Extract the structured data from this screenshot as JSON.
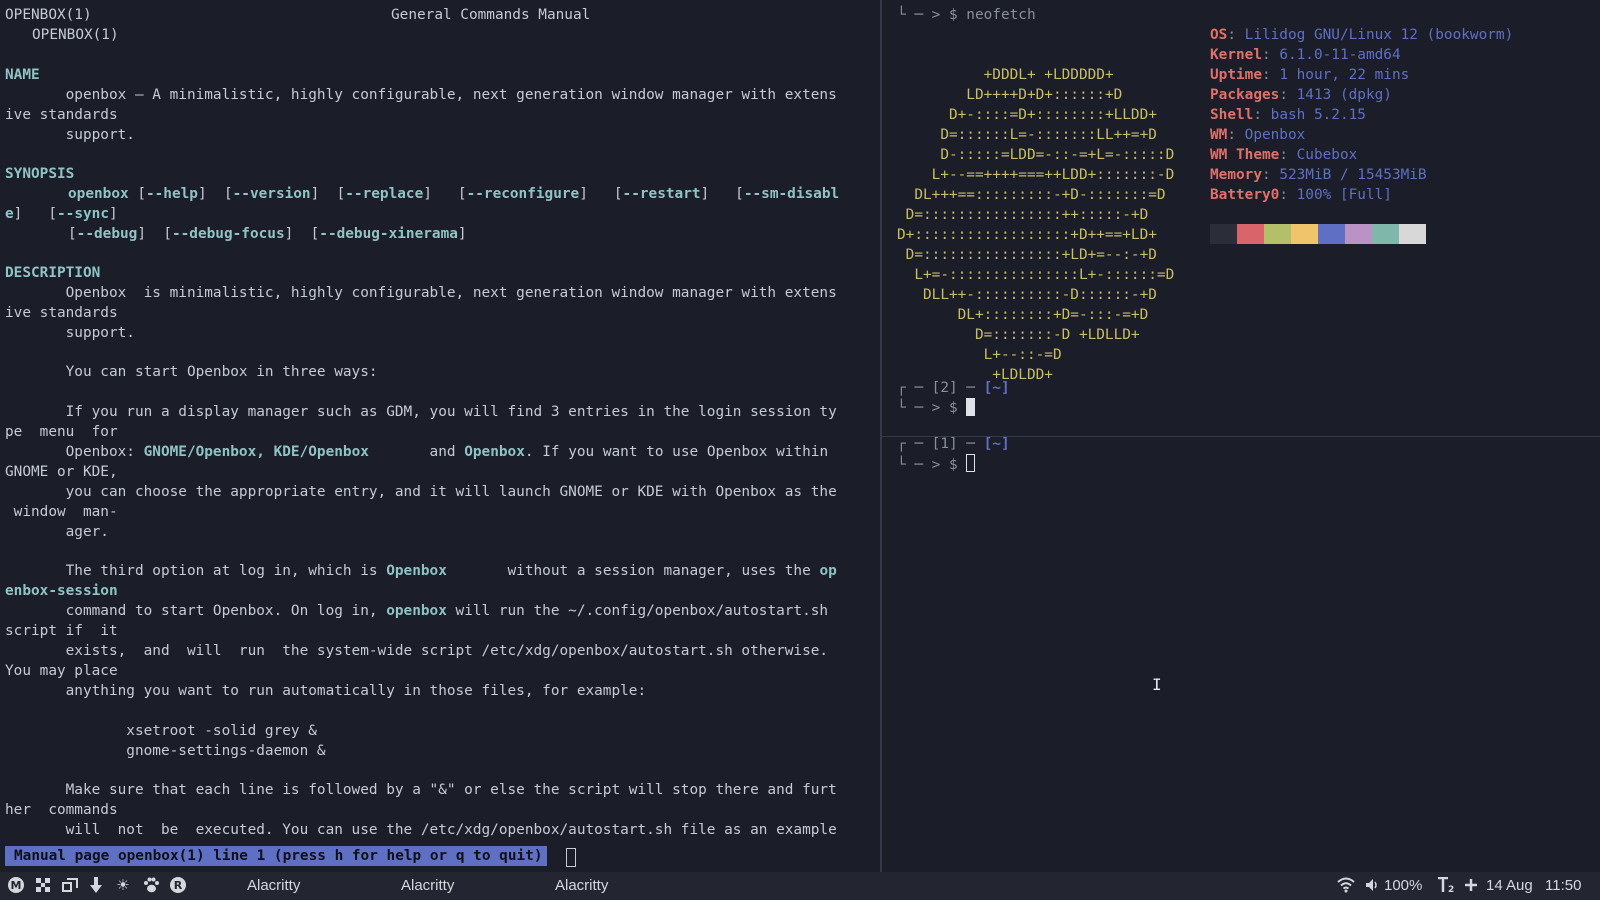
{
  "colors": {
    "background": "#1b1e28",
    "foreground": "#c6cad6",
    "bold": "#8fc3c6",
    "status_bg": "#5f6fc4",
    "logo": "#c8bd68",
    "label": "#e0706a",
    "value": "#5f6fc4"
  },
  "man": {
    "header_left": "OPENBOX(1)",
    "header_center": "General Commands Manual",
    "header_right": "OPENBOX(1)",
    "name_heading": "NAME",
    "name_line1": "       openbox — A minimalistic, highly configurable, next generation window manager with extens",
    "name_line2": "ive standards",
    "name_line3": "       support.",
    "synopsis_heading": "SYNOPSIS",
    "syn_cmd": "openbox",
    "syn_help": "--help",
    "syn_version": "--version",
    "syn_replace": "--replace",
    "syn_reconfigure": "--reconfigure",
    "syn_restart": "--restart",
    "syn_smdisable_a": "--sm-disabl",
    "syn_smdisable_b": "e",
    "syn_sync": "--sync",
    "syn_debug": "--debug",
    "syn_debug_focus": "--debug-focus",
    "syn_debug_xinerama": "--debug-xinerama",
    "description_heading": "DESCRIPTION",
    "d1": "       Openbox  is minimalistic, highly configurable, next generation window manager with extens",
    "d2": "ive standards",
    "d3": "       support.",
    "d4": "       You can start Openbox in three ways:",
    "d5": "       If you run a display manager such as GDM, you will find 3 entries in the login session ty",
    "d6": "pe  menu  for",
    "d7_a": "       Openbox: ",
    "d7_b": "GNOME/Openbox",
    "d7_c": ", ",
    "d7_d": "KDE/Openbox",
    "d7_e": "       and ",
    "d7_f": "Openbox",
    "d7_g": ". If you want to use Openbox within",
    "d8": "GNOME or KDE,",
    "d9": "       you can choose the appropriate entry, and it will launch GNOME or KDE with Openbox as the",
    "d10": " window  man-",
    "d11": "       ager.",
    "d12_a": "       The third option at log in, which is ",
    "d12_b": "Openbox",
    "d12_c": "       without a session manager, uses the ",
    "d12_d": "op",
    "d13": "enbox-session",
    "d14_a": "       command to start Openbox. On log in, ",
    "d14_b": "openbox",
    "d14_c": " will run the ~/.config/openbox/autostart.sh",
    "d15": "script if  it",
    "d16": "       exists,  and  will  run  the system-wide script /etc/xdg/openbox/autostart.sh otherwise.",
    "d17": "You may place",
    "d18": "       anything you want to run automatically in those files, for example:",
    "d19": "              xsetroot -solid grey &",
    "d20": "              gnome-settings-daemon &",
    "d21": "       Make sure that each line is followed by a \"&\" or else the script will stop there and furt",
    "d22": "her  commands",
    "d23": "       will  not  be  executed. You can use the /etc/xdg/openbox/autostart.sh file as an example",
    "status": "Manual page openbox(1) line 1 (press h for help or q to quit)"
  },
  "neofetch": {
    "prompt_top": "└ ─ > $ neofetch",
    "logo": [
      "          +DDDL+ +LDDDDD+",
      "        LD++++D+D+::::::+D",
      "      D+-::::=D+::::::::+LLDD+",
      "     D=::::::L=-:::::::LL++=+D",
      "     D-:::::=LDD=-::-=+L=-:::::D",
      "    L+--==++++===++LDD+:::::::-D",
      "  DL+++==:::::::::-+D-:::::::=D",
      " D=::::::::::::::::++:::::-+D",
      "D+::::::::::::::::::+D++==+LD+",
      " D=::::::::::::::::+LD+=--:-+D",
      "  L+=-:::::::::::::::L+-::::::=D",
      "   DLL++-::::::::::-D::::::-+D",
      "       DL+::::::::+D=-:::-=+D",
      "         D=:::::::-D +LDLLD+",
      "          L+--::-=D",
      "           +LDLDD+"
    ],
    "info": [
      {
        "label": "OS",
        "value": "Lilidog GNU/Linux 12 (bookworm)"
      },
      {
        "label": "Kernel",
        "value": "6.1.0-11-amd64"
      },
      {
        "label": "Uptime",
        "value": "1 hour, 22 mins"
      },
      {
        "label": "Packages",
        "value": "1413 (dpkg)"
      },
      {
        "label": "Shell",
        "value": "bash 5.2.15"
      },
      {
        "label": "WM",
        "value": "Openbox"
      },
      {
        "label": "WM Theme",
        "value": "Cubebox"
      },
      {
        "label": "Memory",
        "value": "523MiB / 15453MiB"
      },
      {
        "label": "Battery0",
        "value": "100% [Full]"
      }
    ],
    "swatches": [
      "#2b2e38",
      "#d9646a",
      "#b4bf6a",
      "#f0c46a",
      "#5f6fc4",
      "#b893c4",
      "#7fb8aa",
      "#d8d8d8"
    ],
    "prompt2_a": "┌ ─ [2] ─ ",
    "prompt2_b": "[~]",
    "prompt2_c": "└ ─ > $ "
  },
  "term1": {
    "prompt1_a": "┌ ─ [1] ─ ",
    "prompt1_b": "[~]",
    "prompt1_c": "└ ─ > $ "
  },
  "taskbar": {
    "icons": [
      "menu-icon",
      "grid-icon",
      "windows-icon",
      "download-icon",
      "sun-icon",
      "paw-icon",
      "r-icon"
    ],
    "tasks": [
      "Alacritty",
      "Alacritty",
      "Alacritty"
    ],
    "volume_label": "100%",
    "date": "14 Aug",
    "time": "11:50"
  }
}
